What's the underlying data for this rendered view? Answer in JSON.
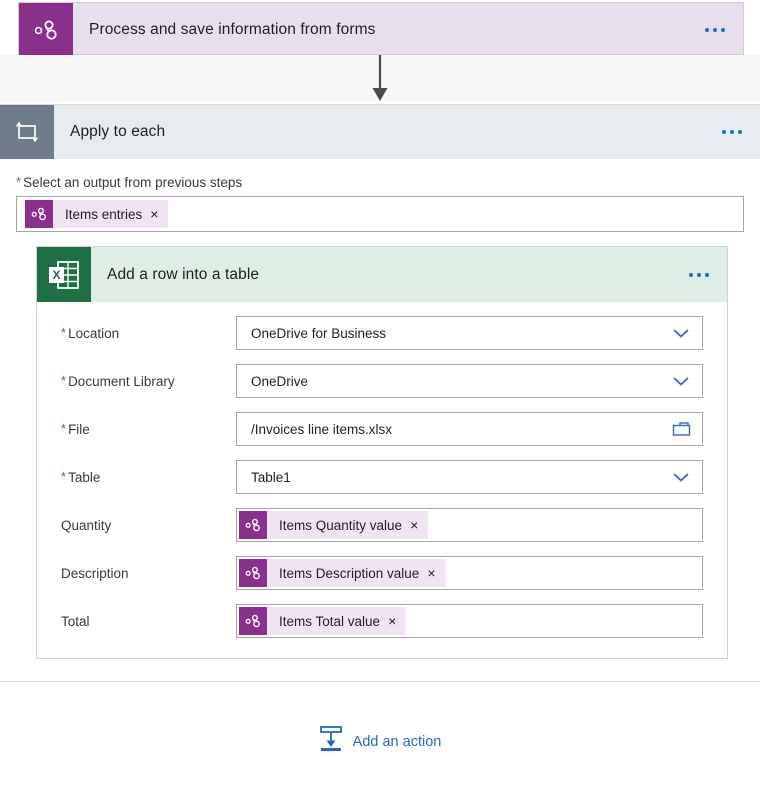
{
  "trigger": {
    "title": "Process and save information from forms",
    "icon": "dynamic-content-icon",
    "menu_label": "...",
    "header_color": "#e8dfec",
    "icon_color": "#8a2f8c"
  },
  "connector": {
    "icon": "down-arrow-icon",
    "color": "#4a4a4a"
  },
  "loop": {
    "title": "Apply to each",
    "icon": "repeat-loop-icon",
    "menu_label": "...",
    "header_color": "#e7ebee",
    "icon_color": "#6e7b8b",
    "output_field": {
      "label": "Select an output from previous steps",
      "required": true,
      "token": {
        "label": "Items entries",
        "close": "×",
        "icon": "dynamic-content-icon"
      }
    }
  },
  "excel": {
    "title": "Add a row into a table",
    "icon": "excel-icon",
    "menu_label": "...",
    "header_color": "#dfeee4",
    "icon_color": "#1d7044",
    "fields": [
      {
        "label": "Location",
        "required": true,
        "type": "dropdown",
        "value": "OneDrive for Business",
        "affordance": "chevron-down-icon"
      },
      {
        "label": "Document Library",
        "required": true,
        "type": "dropdown",
        "value": "OneDrive",
        "affordance": "chevron-down-icon"
      },
      {
        "label": "File",
        "required": true,
        "type": "filepicker",
        "value": "/Invoices line items.xlsx",
        "affordance": "folder-icon"
      },
      {
        "label": "Table",
        "required": true,
        "type": "dropdown",
        "value": "Table1",
        "affordance": "chevron-down-icon"
      },
      {
        "label": "Quantity",
        "required": false,
        "type": "token",
        "value": "Items Quantity value",
        "close": "×",
        "affordance": ""
      },
      {
        "label": "Description",
        "required": false,
        "type": "token",
        "value": "Items Description value",
        "close": "×",
        "affordance": ""
      },
      {
        "label": "Total",
        "required": false,
        "type": "token",
        "value": "Items Total value",
        "close": "×",
        "affordance": ""
      }
    ]
  },
  "add_action": {
    "label": "Add an action",
    "icon": "insert-action-icon",
    "color": "#1f6bc4"
  },
  "colors": {
    "accent_blue": "#2266dd",
    "required_red": "#d13438",
    "token_purple": "#8a2f8c",
    "token_bg": "#f0e4f3",
    "excel_green": "#1d7044",
    "page_bg": "#ffffff"
  }
}
